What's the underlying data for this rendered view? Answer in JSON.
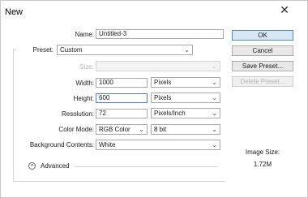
{
  "window": {
    "title": "New",
    "close_glyph": "✕"
  },
  "form": {
    "name_label": "Name:",
    "name_value": "Untitled-3",
    "preset_label": "Preset:",
    "preset_value": "Custom",
    "size_label": "Size:",
    "size_value": "",
    "width_label": "Width:",
    "width_value": "1000",
    "width_unit": "Pixels",
    "height_label": "Height:",
    "height_value": "600",
    "height_unit": "Pixels",
    "resolution_label": "Resolution:",
    "resolution_value": "72",
    "resolution_unit": "Pixels/Inch",
    "color_mode_label": "Color Mode:",
    "color_mode_value": "RGB Color",
    "bit_depth_value": "8 bit",
    "background_label": "Background Contents:",
    "background_value": "White",
    "advanced_label": "Advanced"
  },
  "buttons": {
    "ok": "OK",
    "cancel": "Cancel",
    "save_preset": "Save Preset...",
    "delete_preset": "Delete Preset..."
  },
  "info": {
    "image_size_label": "Image Size:",
    "image_size_value": "1.72M"
  },
  "icons": {
    "chevron": "chevron-down-icon",
    "advanced": "double-chevron-down-icon",
    "close": "close-icon"
  }
}
